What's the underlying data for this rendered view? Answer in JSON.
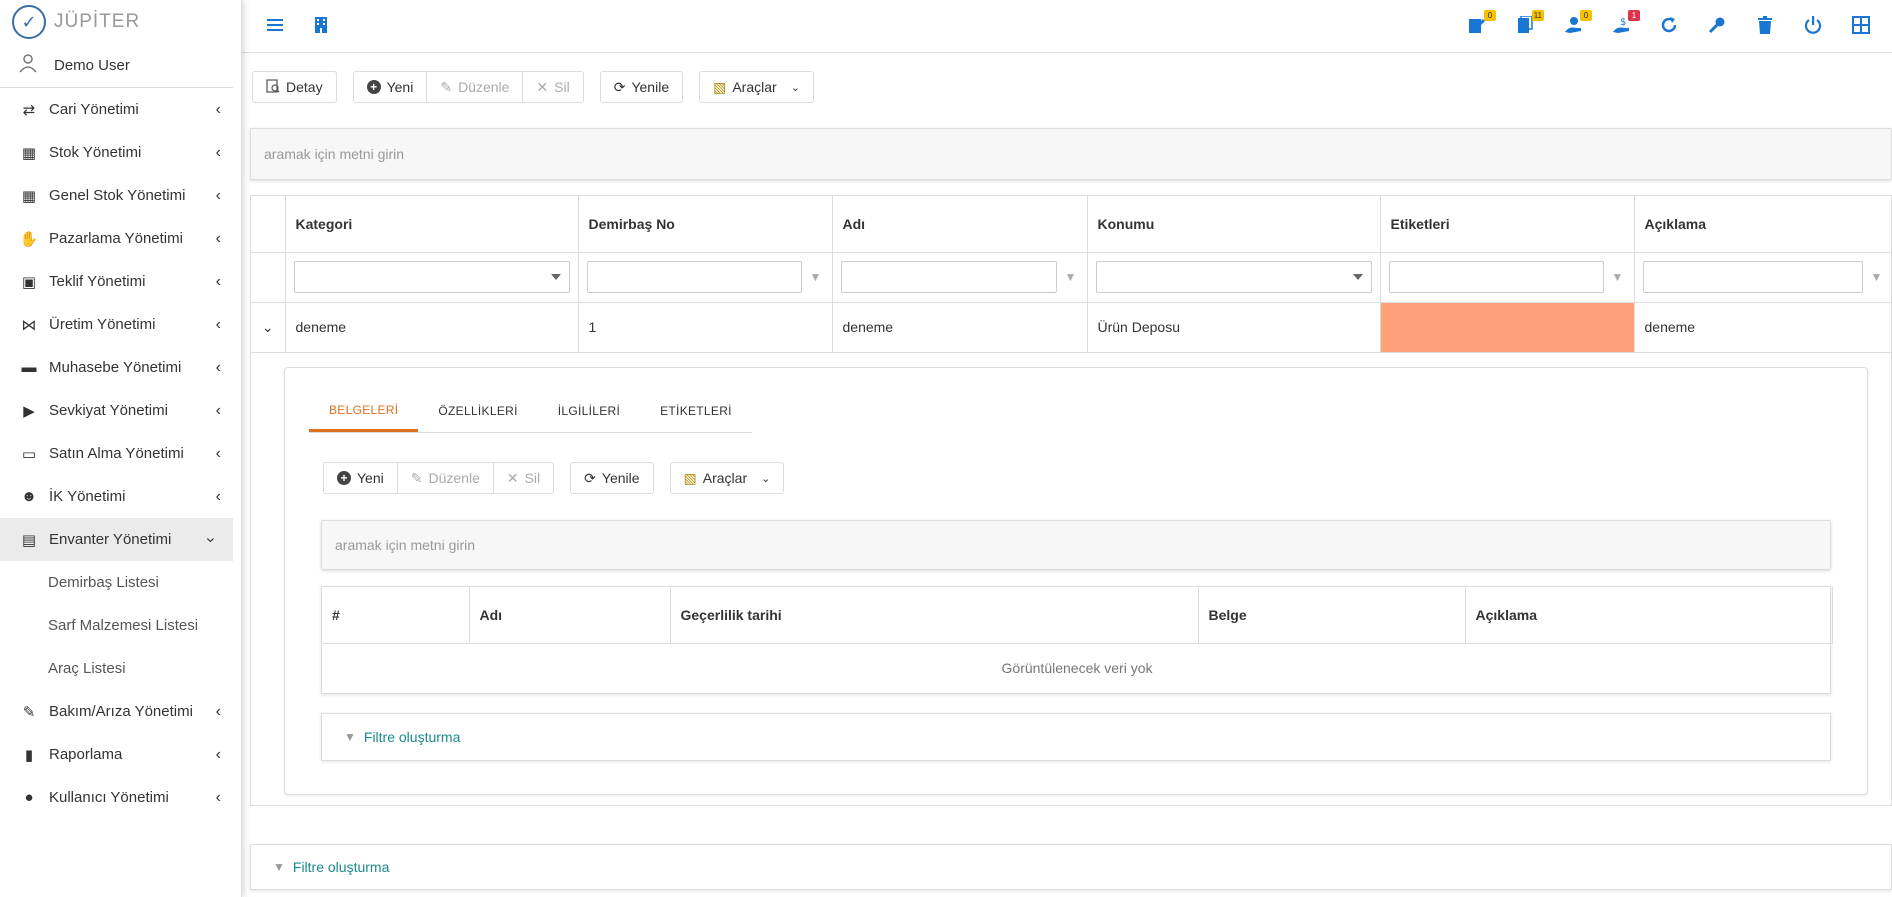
{
  "app": {
    "name": "JÜPİTER",
    "logo_glyph": "✓"
  },
  "user": {
    "name": "Demo User"
  },
  "sidebar": {
    "items": [
      {
        "label": "Cari Yönetimi",
        "icon": "people-arrows-icon",
        "glyph": "⇄"
      },
      {
        "label": "Stok Yönetimi",
        "icon": "boxes-icon",
        "glyph": "▦"
      },
      {
        "label": "Genel Stok Yönetimi",
        "icon": "boxes-icon",
        "glyph": "▦"
      },
      {
        "label": "Pazarlama Yönetimi",
        "icon": "handshake-icon",
        "glyph": "✋"
      },
      {
        "label": "Teklif Yönetimi",
        "icon": "box-open-icon",
        "glyph": "▣"
      },
      {
        "label": "Üretim Yönetimi",
        "icon": "project-diagram-icon",
        "glyph": "⋈"
      },
      {
        "label": "Muhasebe Yönetimi",
        "icon": "money-bill-icon",
        "glyph": "▬"
      },
      {
        "label": "Sevkiyat Yönetimi",
        "icon": "truck-icon",
        "glyph": "▶"
      },
      {
        "label": "Satın Alma Yönetimi",
        "icon": "credit-card-icon",
        "glyph": "▭"
      },
      {
        "label": "İK Yönetimi",
        "icon": "users-icon",
        "glyph": "☻"
      },
      {
        "label": "Envanter Yönetimi",
        "icon": "warehouse-icon",
        "glyph": "▤"
      }
    ],
    "subitems": [
      {
        "label": "Demirbaş Listesi"
      },
      {
        "label": "Sarf Malzemesi Listesi"
      },
      {
        "label": "Araç Listesi"
      }
    ],
    "items_after": [
      {
        "label": "Bakım/Arıza Yönetimi",
        "icon": "wrench-icon",
        "glyph": "✎"
      },
      {
        "label": "Raporlama",
        "icon": "book-icon",
        "glyph": "▮"
      },
      {
        "label": "Kullanıcı Yönetimi",
        "icon": "user-icon",
        "glyph": "●"
      }
    ]
  },
  "topbar": {
    "left_icons": [
      "menu-icon",
      "building-icon"
    ],
    "right_icons": [
      {
        "name": "task-edit-icon",
        "badge": "0",
        "badge_color": "#f5c000"
      },
      {
        "name": "documents-icon",
        "badge": "11",
        "badge_color": "#f5c000"
      },
      {
        "name": "user-hand-icon",
        "badge": "0",
        "badge_color": "#f5c000"
      },
      {
        "name": "money-hand-icon",
        "badge": "1",
        "badge_color": "#d9364c"
      },
      {
        "name": "refresh-icon"
      },
      {
        "name": "key-icon"
      },
      {
        "name": "trash-icon"
      },
      {
        "name": "power-icon"
      },
      {
        "name": "grid-icon"
      }
    ],
    "accent": "#1976d2"
  },
  "toolbar": {
    "detail": "Detay",
    "new": "Yeni",
    "edit": "Düzenle",
    "delete": "Sil",
    "refresh": "Yenile",
    "tools": "Araçlar"
  },
  "search": {
    "placeholder": "aramak için metni girin"
  },
  "grid": {
    "columns": [
      "Kategori",
      "Demirbaş No",
      "Adı",
      "Konumu",
      "Etiketleri",
      "Açıklama"
    ],
    "rows": [
      {
        "kategori": "deneme",
        "demirbas_no": "1",
        "adi": "deneme",
        "konumu": "Ürün Deposu",
        "etiketleri": "",
        "etiket_color": "#ffa07a",
        "aciklama": "deneme"
      }
    ]
  },
  "detail": {
    "tabs": [
      "BELGELERİ",
      "ÖZELLİKLERİ",
      "İLGİLİLERİ",
      "ETİKETLERİ"
    ],
    "active_tab": "BELGELERİ",
    "toolbar": {
      "new": "Yeni",
      "edit": "Düzenle",
      "delete": "Sil",
      "refresh": "Yenile",
      "tools": "Araçlar"
    },
    "search_placeholder": "aramak için metni girin",
    "columns": [
      "#",
      "Adı",
      "Geçerlilik tarihi",
      "Belge",
      "Açıklama"
    ],
    "empty_text": "Görüntülenecek veri yok",
    "filter_label": "Filtre oluşturma"
  },
  "footer": {
    "filter_label": "Filtre oluşturma"
  }
}
